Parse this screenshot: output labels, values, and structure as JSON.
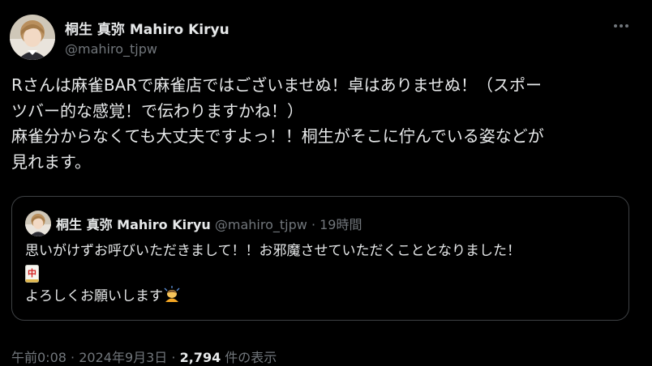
{
  "author": {
    "name": "桐生 真弥 Mahiro Kiryu",
    "handle": "@mahiro_tjpw"
  },
  "tweet": {
    "text": "Rさんは麻雀BARで麻雀店ではございませぬ！卓はありませぬ！（スポー\nツバー的な感覚！で伝わりますかね！）\n麻雀分からなくても大丈夫ですよっ！！桐生がそこに佇んでいる姿などが\n見れます。"
  },
  "quote": {
    "name": "桐生 真弥 Mahiro Kiryu",
    "handle": "@mahiro_tjpw",
    "separator": "·",
    "time": "19時間",
    "line1": "思いがけずお呼びいただきまして！！お邪魔させていただくこととなりました！",
    "tile_char": "中",
    "line3": "よろしくお願いします"
  },
  "meta": {
    "time": "午前0:08",
    "separator": "·",
    "date": "2024年9月3日",
    "views_count": "2,794",
    "views_label": "件の表示"
  },
  "icons": {
    "more": "more-horizontal-icon",
    "tile": "mahjong-red-dragon-icon",
    "bow": "person-bowing-icon"
  },
  "colors": {
    "background": "#000000",
    "text": "#e7e9ea",
    "secondary": "#71767b",
    "border": "#3e4144",
    "tile_red": "#d32020"
  }
}
